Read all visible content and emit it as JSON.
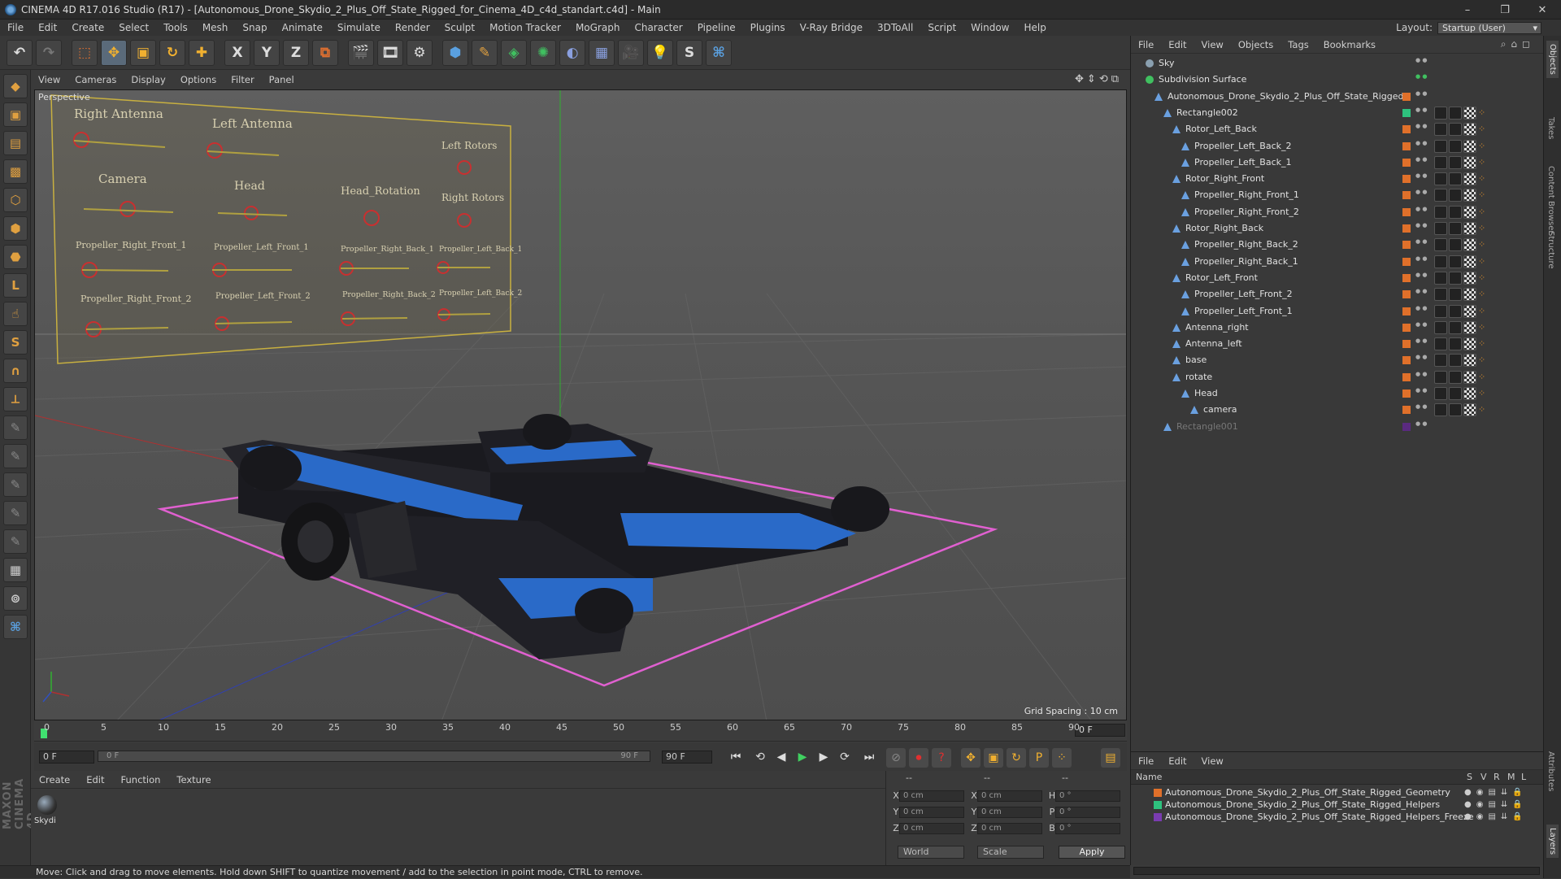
{
  "window": {
    "title": "CINEMA 4D R17.016 Studio (R17) - [Autonomous_Drone_Skydio_2_Plus_Off_State_Rigged_for_Cinema_4D_c4d_standart.c4d] - Main",
    "minimize": "–",
    "maximize": "❐",
    "close": "✕"
  },
  "menubar": [
    "File",
    "Edit",
    "Create",
    "Select",
    "Tools",
    "Mesh",
    "Snap",
    "Animate",
    "Simulate",
    "Render",
    "Sculpt",
    "Motion Tracker",
    "MoGraph",
    "Character",
    "Pipeline",
    "Plugins",
    "V-Ray Bridge",
    "3DToAll",
    "Script",
    "Window",
    "Help"
  ],
  "layout": {
    "label": "Layout:",
    "value": "Startup (User)"
  },
  "toolbar": {
    "tools": [
      "undo",
      "redo",
      "live-select",
      "move",
      "scale",
      "rotate",
      "add"
    ],
    "axes": [
      "X",
      "Y",
      "Z"
    ]
  },
  "viewport": {
    "menu": [
      "View",
      "Cameras",
      "Display",
      "Options",
      "Filter",
      "Panel"
    ],
    "label": "Perspective",
    "grid_spacing": "Grid Spacing : 10 cm",
    "rig_labels": [
      "Right Antenna",
      "Left Antenna",
      "Left Rotors",
      "Camera",
      "Head",
      "Head_Rotation",
      "Right Rotors",
      "Propeller_Right_Front_1",
      "Propeller_Left_Front_1",
      "Propeller_Right_Back_1",
      "Propeller_Left_Back_1",
      "Propeller_Right_Front_2",
      "Propeller_Left_Front_2",
      "Propeller_Right_Back_2",
      "Propeller_Left_Back_2"
    ]
  },
  "timeline": {
    "ticks": [
      "0",
      "5",
      "10",
      "15",
      "20",
      "25",
      "30",
      "35",
      "40",
      "45",
      "50",
      "55",
      "60",
      "65",
      "70",
      "75",
      "80",
      "85",
      "90"
    ],
    "current_frame": "0 F"
  },
  "transport": {
    "start_field": "0 F",
    "slider_start": "0 F",
    "slider_end": "90 F",
    "end_field": "90 F"
  },
  "material_panel": {
    "menu": [
      "Create",
      "Edit",
      "Function",
      "Texture"
    ],
    "material_name": "Skydi"
  },
  "coord_panel": {
    "header": [
      "--",
      "--",
      "--"
    ],
    "rows": [
      {
        "a": "X",
        "av": "0 cm",
        "b": "X",
        "bv": "0 cm",
        "c": "H",
        "cv": "0 °"
      },
      {
        "a": "Y",
        "av": "0 cm",
        "b": "Y",
        "bv": "0 cm",
        "c": "P",
        "cv": "0 °"
      },
      {
        "a": "Z",
        "av": "0 cm",
        "b": "Z",
        "bv": "0 cm",
        "c": "B",
        "cv": "0 °"
      }
    ],
    "mode": "World",
    "scale": "Scale",
    "apply": "Apply"
  },
  "status": "Move: Click and drag to move elements. Hold down SHIFT to quantize movement / add to the selection in point mode, CTRL to remove.",
  "object_manager": {
    "menu": [
      "File",
      "Edit",
      "View",
      "Objects",
      "Tags",
      "Bookmarks"
    ],
    "objects": [
      {
        "name": "Sky",
        "indent": 0,
        "tags": false
      },
      {
        "name": "Subdivision Surface",
        "indent": 0,
        "tags": false
      },
      {
        "name": "Autonomous_Drone_Skydio_2_Plus_Off_State_Rigged",
        "indent": 1,
        "tags": false
      },
      {
        "name": "Rectangle002",
        "indent": 2,
        "tags": true
      },
      {
        "name": "Rotor_Left_Back",
        "indent": 3,
        "tags": true
      },
      {
        "name": "Propeller_Left_Back_2",
        "indent": 4,
        "tags": true
      },
      {
        "name": "Propeller_Left_Back_1",
        "indent": 4,
        "tags": true
      },
      {
        "name": "Rotor_Right_Front",
        "indent": 3,
        "tags": true
      },
      {
        "name": "Propeller_Right_Front_1",
        "indent": 4,
        "tags": true
      },
      {
        "name": "Propeller_Right_Front_2",
        "indent": 4,
        "tags": true
      },
      {
        "name": "Rotor_Right_Back",
        "indent": 3,
        "tags": true
      },
      {
        "name": "Propeller_Right_Back_2",
        "indent": 4,
        "tags": true
      },
      {
        "name": "Propeller_Right_Back_1",
        "indent": 4,
        "tags": true
      },
      {
        "name": "Rotor_Left_Front",
        "indent": 3,
        "tags": true
      },
      {
        "name": "Propeller_Left_Front_2",
        "indent": 4,
        "tags": true
      },
      {
        "name": "Propeller_Left_Front_1",
        "indent": 4,
        "tags": true
      },
      {
        "name": "Antenna_right",
        "indent": 3,
        "tags": true
      },
      {
        "name": "Antenna_left",
        "indent": 3,
        "tags": true
      },
      {
        "name": "base",
        "indent": 3,
        "tags": true
      },
      {
        "name": "rotate",
        "indent": 3,
        "tags": true
      },
      {
        "name": "Head",
        "indent": 4,
        "tags": true
      },
      {
        "name": "camera",
        "indent": 5,
        "tags": true
      },
      {
        "name": "Rectangle001",
        "indent": 2,
        "tags": false
      }
    ]
  },
  "layer_manager": {
    "menu": [
      "File",
      "Edit",
      "View"
    ],
    "header": {
      "name": "Name",
      "cols": [
        "S",
        "V",
        "R",
        "M",
        "L"
      ]
    },
    "layers": [
      {
        "name": "Autonomous_Drone_Skydio_2_Plus_Off_State_Rigged_Geometry",
        "color": "#e0702a"
      },
      {
        "name": "Autonomous_Drone_Skydio_2_Plus_Off_State_Rigged_Helpers",
        "color": "#2ec27e"
      },
      {
        "name": "Autonomous_Drone_Skydio_2_Plus_Off_State_Rigged_Helpers_Freeze",
        "color": "#7a3cb0"
      }
    ]
  },
  "right_tabs": [
    "Objects",
    "Takes",
    "Content Browser",
    "Structure",
    "Attributes",
    "Layers"
  ]
}
